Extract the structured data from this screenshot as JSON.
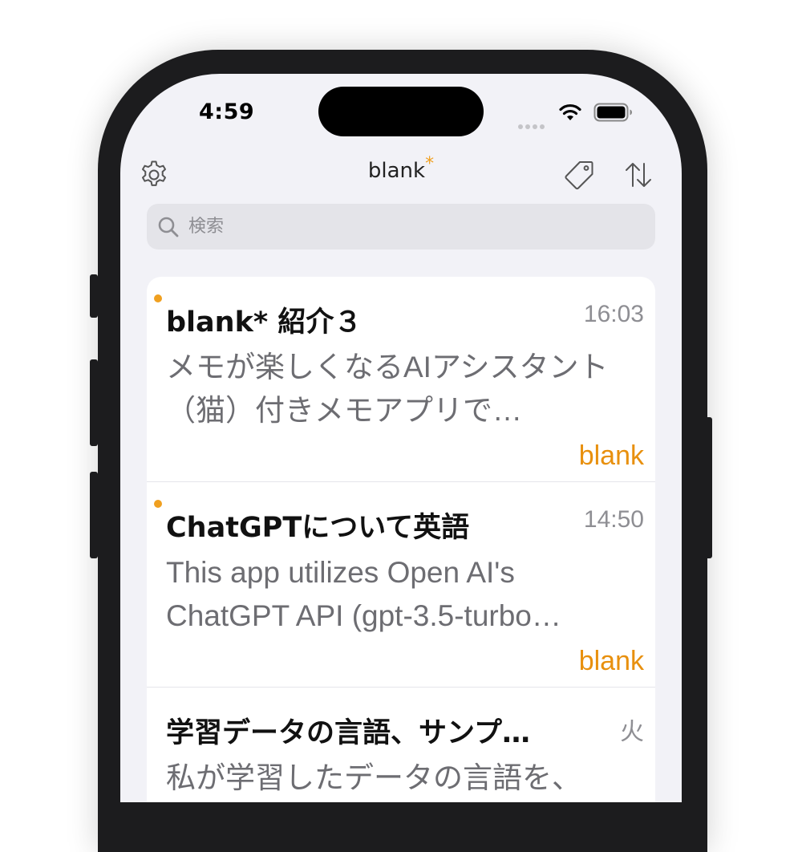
{
  "status_bar": {
    "time": "4:59"
  },
  "nav": {
    "title": "blank",
    "title_mark": "*"
  },
  "search": {
    "placeholder": "検索"
  },
  "notes": [
    {
      "title": "blank* 紹介３",
      "time": "16:03",
      "preview": "メモが楽しくなるAIアシスタント（猫）付きメモアプリで…",
      "tag": "blank",
      "unread": true
    },
    {
      "title": "ChatGPTについて英語",
      "time": "14:50",
      "preview": "This app utilizes Open AI's ChatGPT API (gpt-3.5-turbo…",
      "tag": "blank",
      "unread": true
    },
    {
      "title": "学習データの言語、サンプ…",
      "time": "火",
      "preview": "私が学習したデータの言語を、",
      "tag": "",
      "unread": false
    }
  ],
  "colors": {
    "accent": "#f0a020",
    "tag": "#e8900e",
    "background": "#f2f2f7"
  }
}
